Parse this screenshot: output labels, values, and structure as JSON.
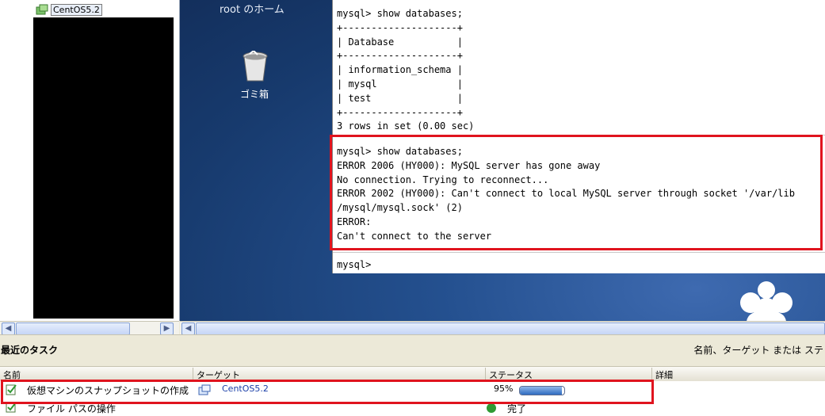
{
  "tree": {
    "vm_name": "CentOS5.2"
  },
  "desktop": {
    "home_label": "root のホーム",
    "trash_label": "ゴミ箱"
  },
  "terminal": {
    "top_output": "mysql> show databases;\n+--------------------+\n| Database           |\n+--------------------+\n| information_schema |\n| mysql              |\n| test               |\n+--------------------+\n3 rows in set (0.00 sec)",
    "error_output": "mysql> show databases;\nERROR 2006 (HY000): MySQL server has gone away\nNo connection. Trying to reconnect...\nERROR 2002 (HY000): Can't connect to local MySQL server through socket '/var/lib\n/mysql/mysql.sock' (2)\nERROR:\nCan't connect to the server",
    "prompt": "mysql>"
  },
  "tasks": {
    "title": "最近のタスク",
    "filter_label": "名前、ターゲット または ステ",
    "columns": {
      "name": "名前",
      "target": "ターゲット",
      "status": "ステータス",
      "details": "詳細"
    },
    "rows": [
      {
        "name": "仮想マシンのスナップショットの作成",
        "target": "CentOS5.2",
        "status": "95%",
        "progress": 0.95
      },
      {
        "name": "ファイル パスの操作",
        "target": "",
        "status": "完了"
      }
    ]
  },
  "colors": {
    "highlight": "#e0141e",
    "desktop_bg": "#24508f",
    "progress": "#2f6cc0"
  }
}
